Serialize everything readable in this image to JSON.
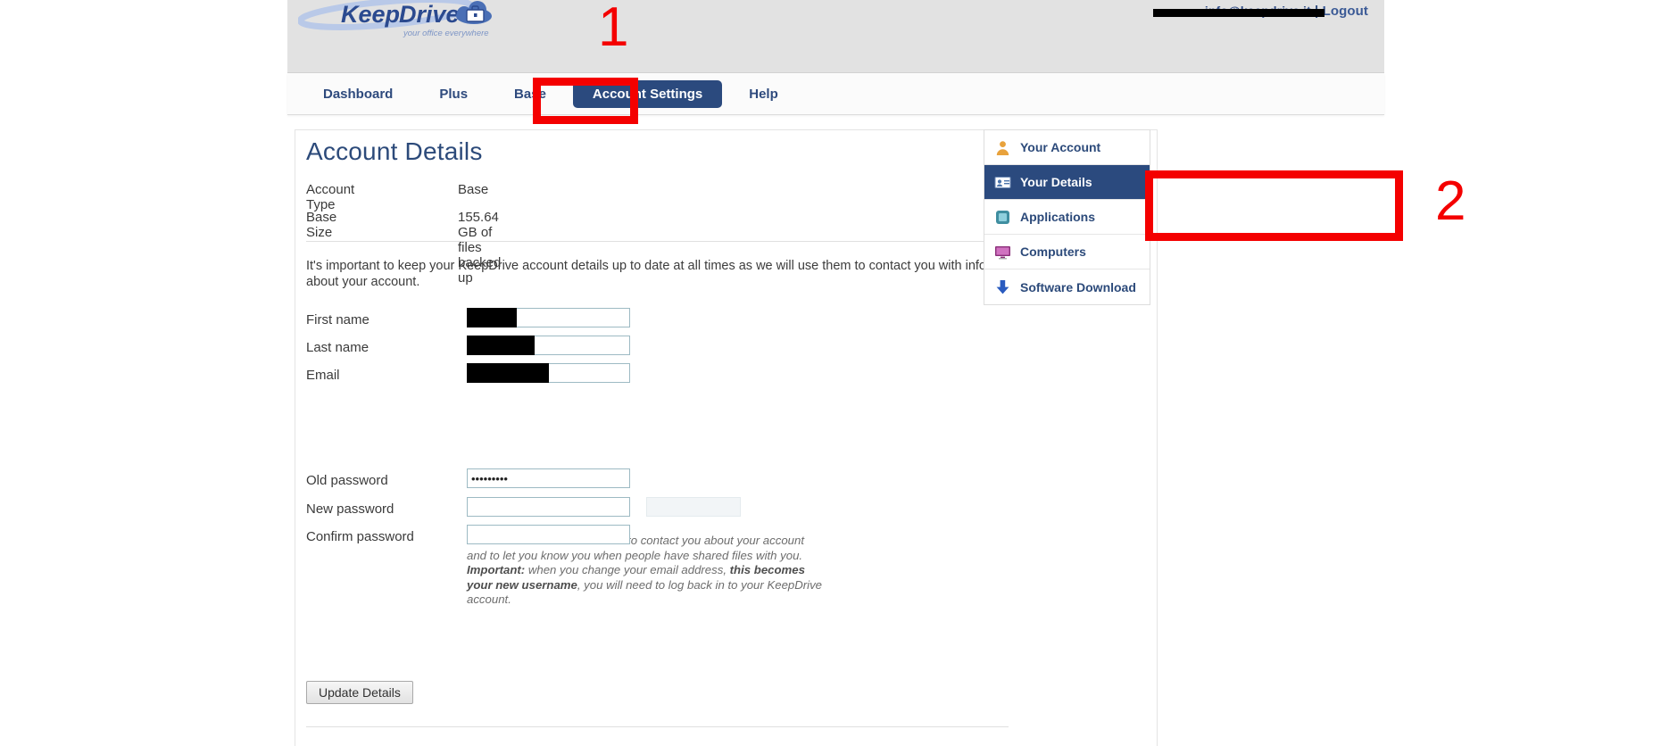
{
  "header": {
    "logo_text": "KeepDrive",
    "logo_tagline": "your office everywhere",
    "account_email": "info@keepdrive.it",
    "separator": "|",
    "logout_label": "Logout"
  },
  "nav": {
    "items": [
      {
        "label": "Dashboard",
        "active": false
      },
      {
        "label": "Plus",
        "active": false
      },
      {
        "label": "Base",
        "active": false
      },
      {
        "label": "Account Settings",
        "active": true
      },
      {
        "label": "Help",
        "active": false
      }
    ]
  },
  "main": {
    "title": "Account Details",
    "info_rows": [
      {
        "label": "Account Type",
        "value": "Base"
      },
      {
        "label": "Base Size",
        "value": "155.64 GB of files backed up"
      }
    ],
    "intro": "It's important to keep your KeepDrive account details up to date at all times as we will use them to contact you with information about your account.",
    "fields": [
      {
        "label": "First name",
        "value": "",
        "redacted": true,
        "redact_width": 56
      },
      {
        "label": "Last name",
        "value": "",
        "redacted": true,
        "redact_width": 76
      },
      {
        "label": "Email",
        "value": "",
        "redacted": true,
        "redact_width": 92
      },
      {
        "label": "Old password",
        "value": "•••••••••",
        "redacted": false
      },
      {
        "label": "New password",
        "value": "",
        "redacted": false
      },
      {
        "label": "Confirm password",
        "value": "",
        "redacted": false
      }
    ],
    "help_line1": "We will use this email address to contact you about your account and to",
    "help_line2": "let you know you when people have shared files with you.",
    "help_important_label": "Important:",
    "help_line3_a": " when you change your email address, ",
    "help_line3_b": "this becomes your new username",
    "help_line3_c": ", you will need to log back in to your KeepDrive account.",
    "update_button": "Update Details"
  },
  "sidebar": {
    "items": [
      {
        "label": "Your Account",
        "icon": "person-icon",
        "active": false
      },
      {
        "label": "Your Details",
        "icon": "id-card-icon",
        "active": true
      },
      {
        "label": "Applications",
        "icon": "applications-icon",
        "active": false
      },
      {
        "label": "Computers",
        "icon": "monitor-icon",
        "active": false
      },
      {
        "label": "Software Download",
        "icon": "download-icon",
        "active": false
      }
    ]
  },
  "annotations": {
    "marker_one": "1",
    "marker_two": "2",
    "color": "#f40000"
  }
}
